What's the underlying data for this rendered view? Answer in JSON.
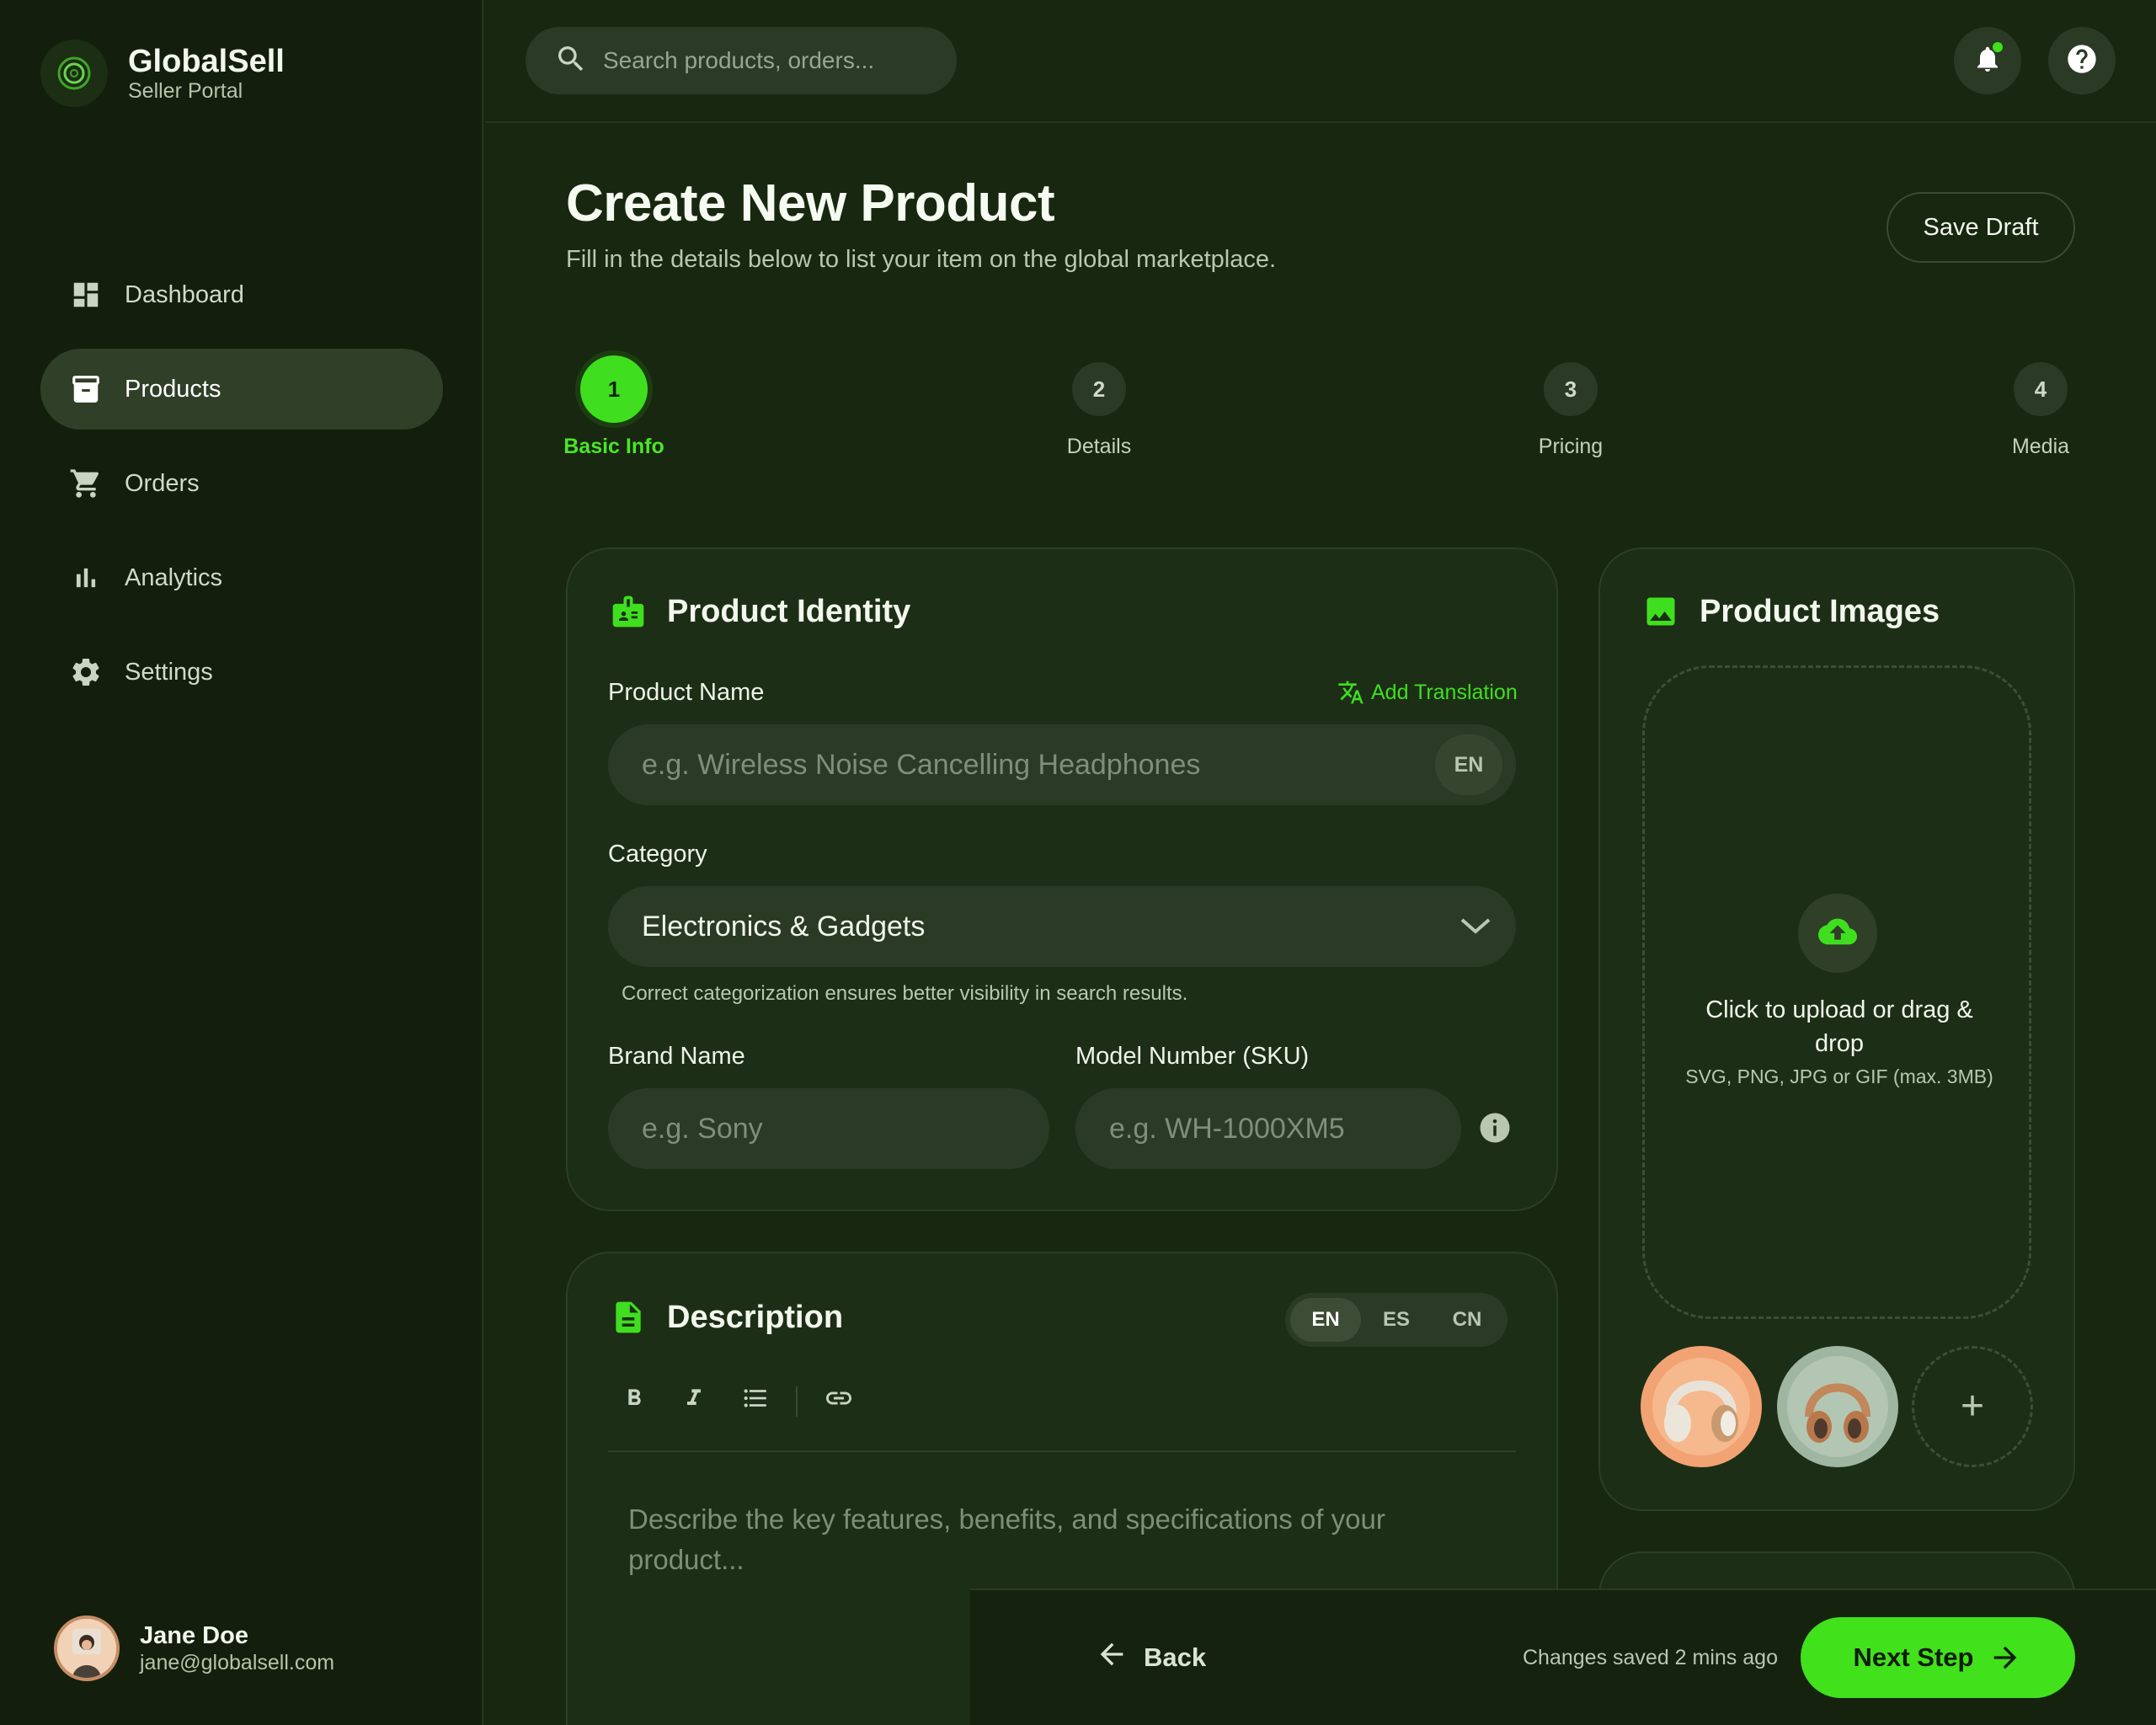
{
  "brand": {
    "name": "GlobalSell",
    "subtitle": "Seller Portal"
  },
  "nav": [
    {
      "label": "Dashboard",
      "icon": "dashboard-icon",
      "active": false
    },
    {
      "label": "Products",
      "icon": "inventory-box-icon",
      "active": true
    },
    {
      "label": "Orders",
      "icon": "cart-icon",
      "active": false
    },
    {
      "label": "Analytics",
      "icon": "bar-chart-icon",
      "active": false
    },
    {
      "label": "Settings",
      "icon": "gear-icon",
      "active": false
    }
  ],
  "user": {
    "name": "Jane Doe",
    "email": "jane@globalsell.com"
  },
  "search": {
    "placeholder": "Search products, orders..."
  },
  "header": {
    "title": "Create New Product",
    "subtitle": "Fill in the details below to list your item on the global marketplace.",
    "save_draft": "Save Draft"
  },
  "steps": [
    {
      "number": "1",
      "label": "Basic Info",
      "active": true
    },
    {
      "number": "2",
      "label": "Details",
      "active": false
    },
    {
      "number": "3",
      "label": "Pricing",
      "active": false
    },
    {
      "number": "4",
      "label": "Media",
      "active": false
    }
  ],
  "identity": {
    "title": "Product Identity",
    "product_name_label": "Product Name",
    "add_translation": "Add Translation",
    "product_name_placeholder": "e.g. Wireless Noise Cancelling Headphones",
    "lang": "EN",
    "category_label": "Category",
    "category_value": "Electronics & Gadgets",
    "category_helper": "Correct categorization ensures better visibility in search results.",
    "brand_label": "Brand Name",
    "brand_placeholder": "e.g. Sony",
    "model_label": "Model Number (SKU)",
    "model_placeholder": "e.g. WH-1000XM5"
  },
  "description": {
    "title": "Description",
    "langs": [
      "EN",
      "ES",
      "CN"
    ],
    "active_lang": "EN",
    "placeholder": "Describe the key features, benefits, and specifications of your product..."
  },
  "images": {
    "title": "Product Images",
    "upload_text": "Click to upload or drag & drop",
    "upload_hint": "SVG, PNG, JPG or GIF (max. 3MB)",
    "add_symbol": "+"
  },
  "footer": {
    "back": "Back",
    "saved": "Changes saved 2 mins ago",
    "next": "Next Step"
  },
  "colors": {
    "accent": "#41e11c",
    "background": "#18270f",
    "sidebar": "#131f0c",
    "card": "#1d2e16"
  }
}
